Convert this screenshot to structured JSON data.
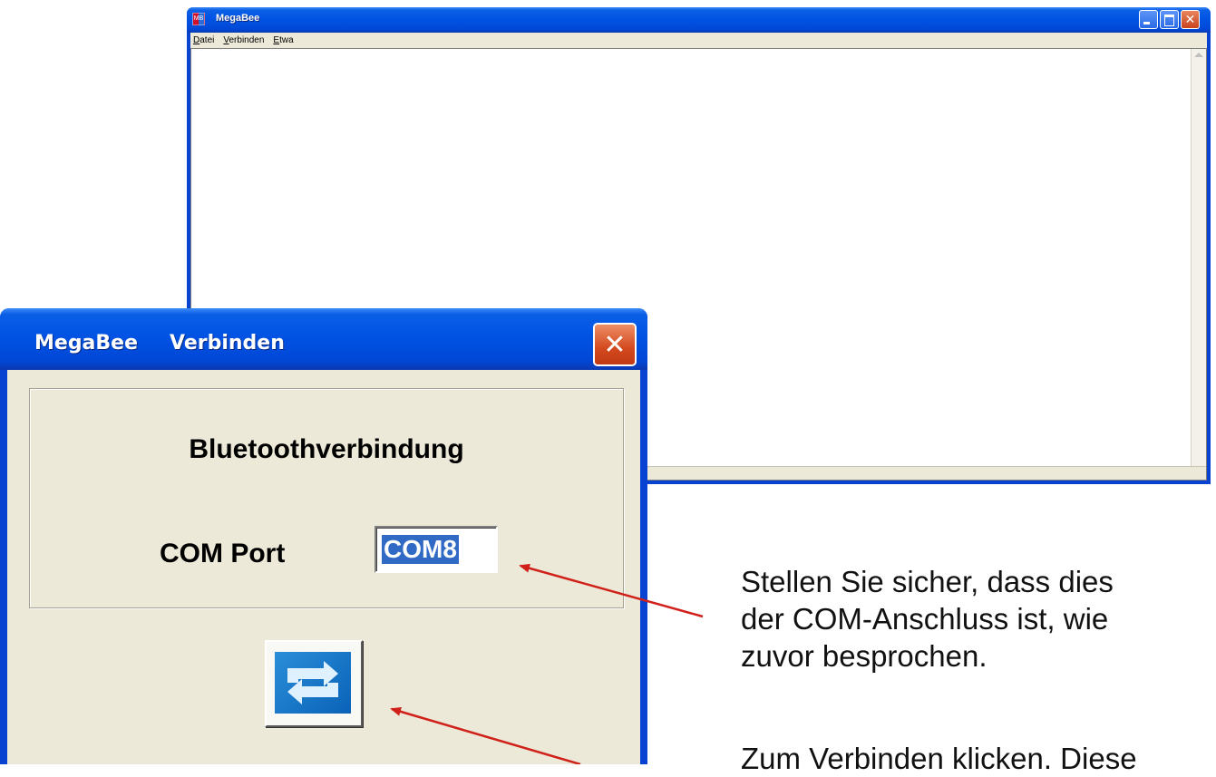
{
  "main_window": {
    "title": "MegaBee",
    "app_icon_text": "MB",
    "menu": [
      "Datei",
      "Verbinden",
      "Etwa"
    ],
    "caption_buttons": [
      "minimize",
      "maximize",
      "close"
    ]
  },
  "dialog": {
    "title_app": "MegaBee",
    "title_name": "Verbinden",
    "group_title": "Bluetoothverbindung",
    "com_label": "COM Port",
    "com_value": "COM8",
    "connect_icon": "connect-arrows-icon"
  },
  "annotations": {
    "note1": [
      "Stellen Sie sicher, dass dies",
      "der COM-Anschluss ist, wie",
      "zuvor besprochen."
    ],
    "note2": [
      "Zum Verbinden klicken. Diese"
    ],
    "arrow_color": "#d0201a"
  },
  "colors": {
    "title_blue": "#0153e3",
    "dialog_bg": "#ece9d8",
    "selection": "#316ac5",
    "close_red": "#d3491f"
  }
}
